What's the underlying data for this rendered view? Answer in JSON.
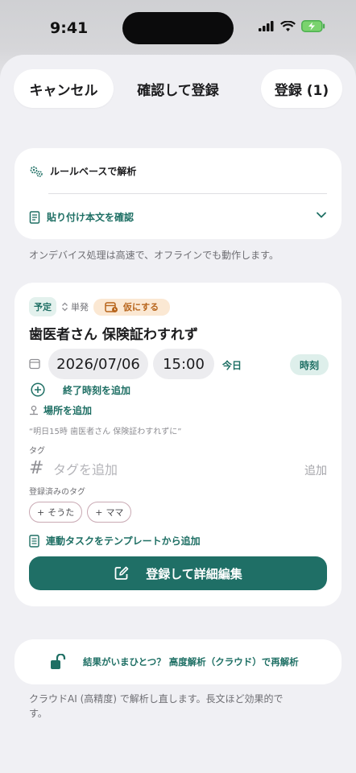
{
  "status_bar": {
    "time": "9:41"
  },
  "nav": {
    "cancel": "キャンセル",
    "title": "確認して登録",
    "register": "登録 (1)"
  },
  "parse": {
    "mode": "ルールベースで解析",
    "check_body": "貼り付け本文を確認",
    "note": "オンデバイス処理は高速で、オフラインでも動作します。"
  },
  "event": {
    "badge": "予定",
    "recurrence": "単発",
    "tentative": "仮にする",
    "title": "歯医者さん 保険証わすれず",
    "date": "2026/07/06",
    "time": "15:00",
    "today": "今日",
    "time_mode": "時刻",
    "add_end_time": "終了時刻を追加",
    "add_place": "場所を追加",
    "source_quote": "“明日15時 歯医者さん 保険証わすれずに”",
    "tag_label": "タグ",
    "tag_placeholder": "タグを追加",
    "tag_add": "追加",
    "registered_tags_label": "登録済みのタグ",
    "registered_tags": [
      "そうた",
      "ママ"
    ],
    "template_link": "連動タスクをテンプレートから追加",
    "primary_button": "登録して詳細編集"
  },
  "cloud": {
    "button": "結果がいまひとつ？ 高度解析（クラウド）で再解析",
    "note": "クラウドAI (高精度) で解析し直します。長文ほど効果的です。"
  },
  "colors": {
    "accent": "#1f6f66",
    "tentative_bg": "#fbe8d3",
    "tentative_fg": "#b7641b"
  }
}
